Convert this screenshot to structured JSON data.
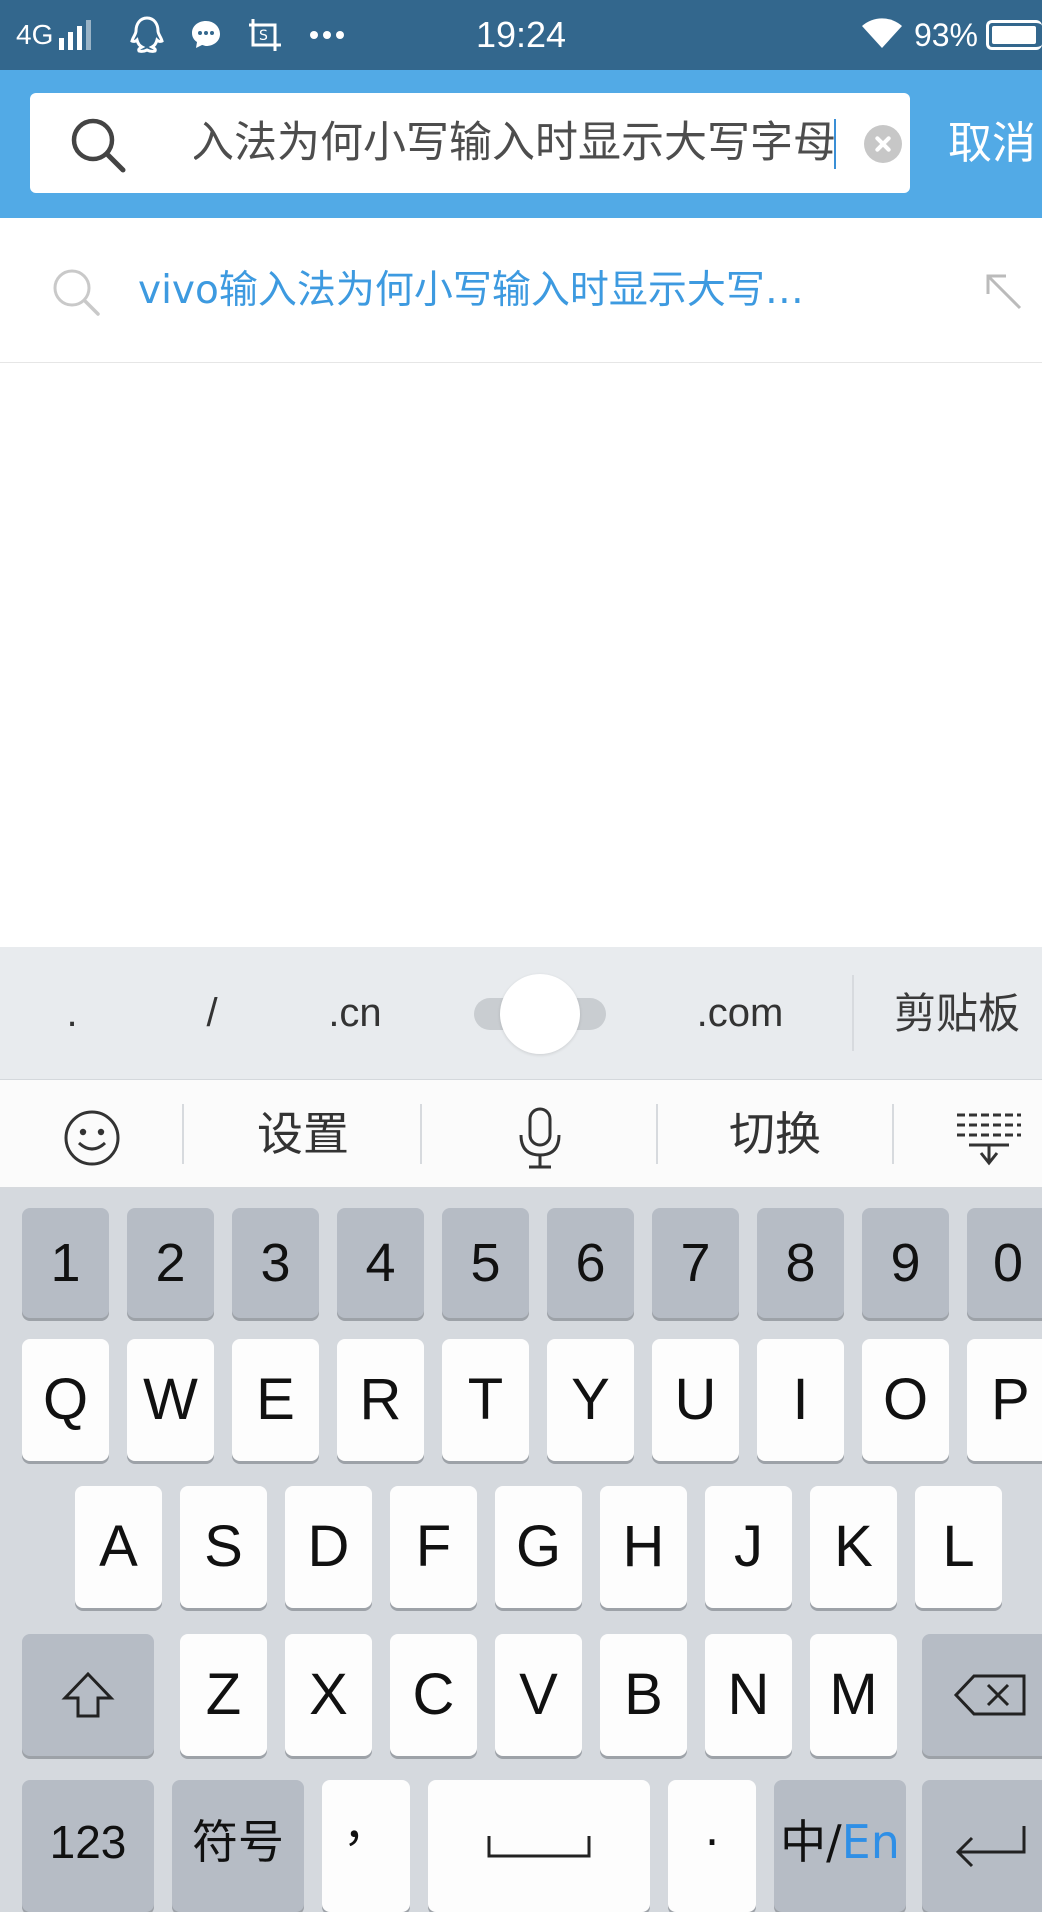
{
  "status_bar": {
    "network": "4G",
    "time": "19:24",
    "battery": "93%",
    "icons": [
      "signal-icon",
      "qq-icon",
      "message-icon",
      "screenshot-icon",
      "more-icon",
      "wifi-icon",
      "battery-icon"
    ]
  },
  "search": {
    "query": "vivo输入法为何小写输入时显示大写字母",
    "cancel_label": "取消"
  },
  "suggestions": [
    {
      "text": "vivo输入法为何小写输入时显示大写…"
    }
  ],
  "keyboard": {
    "quick_keys": [
      ".",
      "/",
      ".cn",
      ".com"
    ],
    "clipboard_label": "剪贴板",
    "toolbar": {
      "settings_label": "设置",
      "switch_label": "切换"
    },
    "number_row": [
      "1",
      "2",
      "3",
      "4",
      "5",
      "6",
      "7",
      "8",
      "9",
      "0"
    ],
    "row1": [
      "Q",
      "W",
      "E",
      "R",
      "T",
      "Y",
      "U",
      "I",
      "O",
      "P"
    ],
    "row2": [
      "A",
      "S",
      "D",
      "F",
      "G",
      "H",
      "J",
      "K",
      "L"
    ],
    "row3": [
      "Z",
      "X",
      "C",
      "V",
      "B",
      "N",
      "M"
    ],
    "bottom": {
      "num_label": "123",
      "symbol_label": "符号",
      "comma_label": "，",
      "dot_label": "·",
      "lang_zh": "中/",
      "lang_en": "En"
    }
  },
  "colors": {
    "status_bar": "#33678d",
    "header": "#52aae6",
    "suggestion_text": "#3d9ae0",
    "keyboard_bg": "#d5d9de"
  }
}
